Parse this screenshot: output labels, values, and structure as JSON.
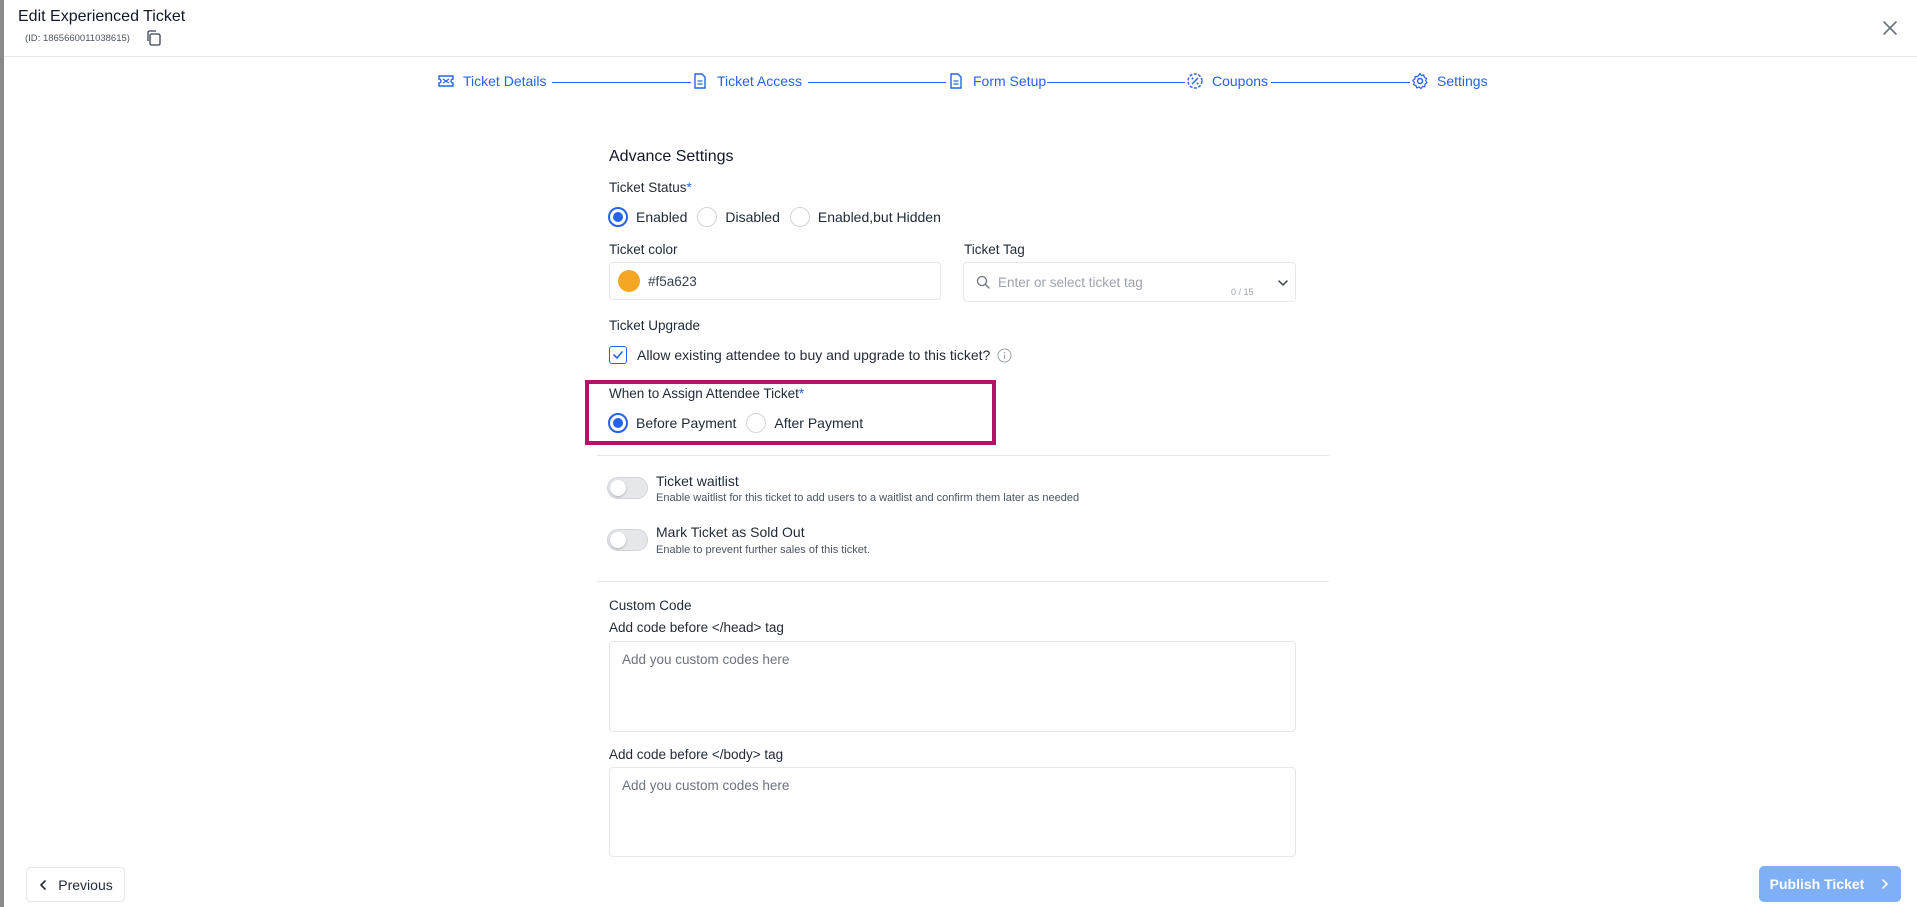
{
  "header": {
    "title": "Edit Experienced Ticket",
    "ticket_id": "(ID: 1865660011038615)"
  },
  "stepper": {
    "steps": [
      {
        "label": "Ticket Details",
        "icon": "ticket-icon"
      },
      {
        "label": "Ticket Access",
        "icon": "document-icon"
      },
      {
        "label": "Form Setup",
        "icon": "document-icon"
      },
      {
        "label": "Coupons",
        "icon": "coupon-icon"
      },
      {
        "label": "Settings",
        "icon": "gear-icon"
      }
    ],
    "accent": "#2563eb"
  },
  "settings": {
    "section_title": "Advance Settings",
    "ticket_status": {
      "label": "Ticket Status",
      "required_mark": "*",
      "options": [
        "Enabled",
        "Disabled",
        "Enabled,but Hidden"
      ],
      "selected": "Enabled"
    },
    "ticket_color": {
      "label": "Ticket color",
      "value": "#f5a623"
    },
    "ticket_tag": {
      "label": "Ticket Tag",
      "placeholder": "Enter or select ticket tag",
      "counter": "0 / 15"
    },
    "ticket_upgrade": {
      "label": "Ticket Upgrade",
      "checkbox_label": "Allow existing attendee to buy and upgrade to this ticket?",
      "checked": true
    },
    "assign_ticket": {
      "label": "When to Assign Attendee Ticket",
      "required_mark": "*",
      "options": [
        "Before Payment",
        "After Payment"
      ],
      "selected": "Before Payment"
    },
    "waitlist": {
      "title": "Ticket waitlist",
      "description": "Enable waitlist for this ticket to add users to a waitlist and confirm them later as needed",
      "enabled": false
    },
    "sold_out": {
      "title": "Mark Ticket as Sold Out",
      "description": "Enable to prevent further sales of this ticket.",
      "enabled": false
    },
    "custom_code": {
      "title": "Custom Code",
      "head_label": "Add code before </head> tag",
      "head_placeholder": "Add you custom codes here",
      "body_label": "Add code before </body> tag",
      "body_placeholder": "Add you custom codes here"
    }
  },
  "footer": {
    "previous_label": "Previous",
    "publish_label": "Publish Ticket"
  },
  "colors": {
    "highlight_box": "#b01466",
    "publish_button": "#7fb0f5"
  }
}
